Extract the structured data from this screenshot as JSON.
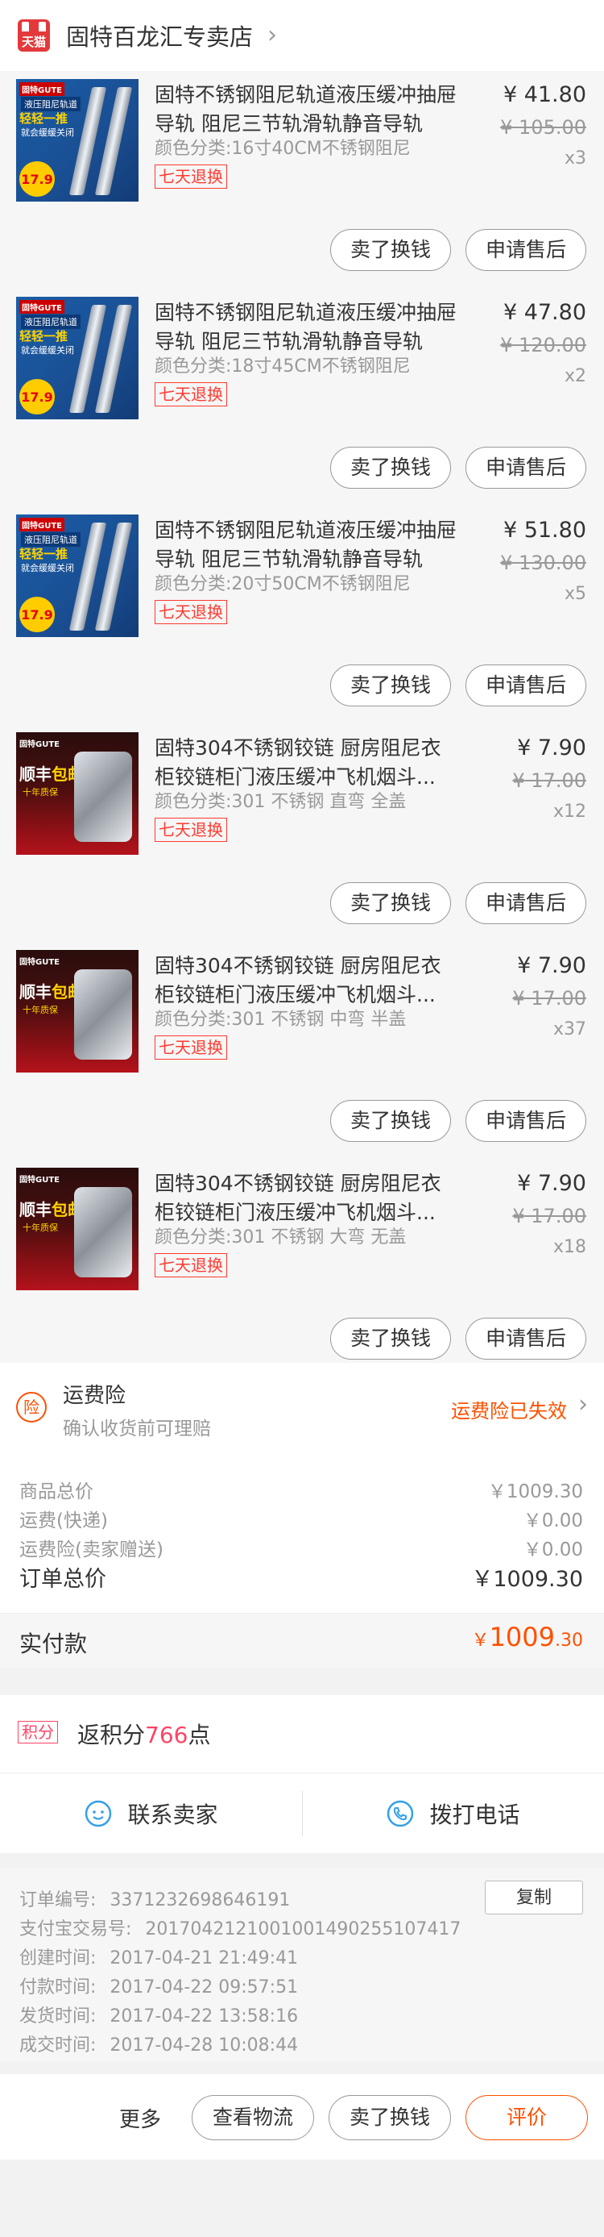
{
  "shop": {
    "logo_text": "天猫",
    "name": "固特百龙汇专卖店",
    "chevron": "›"
  },
  "items": [
    {
      "title": "固特不锈钢阻尼轨道液压缓冲抽屉导轨 阻尼三节轨滑轨静音导轨",
      "sku": "颜色分类:16寸40CM不锈钢阻尼",
      "badge": "七天退换",
      "price": "¥ 41.80",
      "original_price": "¥ 105.00",
      "quantity": "x3",
      "sell_label": "卖了换钱",
      "after_sale_label": "申请售后",
      "thumb": {
        "type": "rail",
        "brand": "固特GUTE",
        "tag1": "液压阻尼轨道",
        "tag2": "轻轻一推",
        "tag3": "就会缓缓关闭",
        "badge": "17.9"
      }
    },
    {
      "title": "固特不锈钢阻尼轨道液压缓冲抽屉导轨 阻尼三节轨滑轨静音导轨",
      "sku": "颜色分类:18寸45CM不锈钢阻尼",
      "badge": "七天退换",
      "price": "¥ 47.80",
      "original_price": "¥ 120.00",
      "quantity": "x2",
      "sell_label": "卖了换钱",
      "after_sale_label": "申请售后",
      "thumb": {
        "type": "rail",
        "brand": "固特GUTE",
        "tag1": "液压阻尼轨道",
        "tag2": "轻轻一推",
        "tag3": "就会缓缓关闭",
        "badge": "17.9"
      }
    },
    {
      "title": "固特不锈钢阻尼轨道液压缓冲抽屉导轨 阻尼三节轨滑轨静音导轨",
      "sku": "颜色分类:20寸50CM不锈钢阻尼",
      "badge": "七天退换",
      "price": "¥ 51.80",
      "original_price": "¥ 130.00",
      "quantity": "x5",
      "sell_label": "卖了换钱",
      "after_sale_label": "申请售后",
      "thumb": {
        "type": "rail",
        "brand": "固特GUTE",
        "tag1": "液压阻尼轨道",
        "tag2": "轻轻一推",
        "tag3": "就会缓缓关闭",
        "badge": "17.9"
      }
    },
    {
      "title": "固特304不锈钢铰链 厨房阻尼衣柜铰链柜门液压缓冲飞机烟斗...",
      "sku": "颜色分类:301 不锈钢 直弯 全盖",
      "badge": "七天退换",
      "price": "¥ 7.90",
      "original_price": "¥ 17.00",
      "quantity": "x12",
      "sell_label": "卖了换钱",
      "after_sale_label": "申请售后",
      "thumb": {
        "type": "hinge",
        "brand": "固特GUTE",
        "big": "顺丰",
        "big2": "包邮",
        "sub": "十年质保"
      }
    },
    {
      "title": "固特304不锈钢铰链 厨房阻尼衣柜铰链柜门液压缓冲飞机烟斗...",
      "sku": "颜色分类:301 不锈钢 中弯 半盖",
      "badge": "七天退换",
      "price": "¥ 7.90",
      "original_price": "¥ 17.00",
      "quantity": "x37",
      "sell_label": "卖了换钱",
      "after_sale_label": "申请售后",
      "thumb": {
        "type": "hinge",
        "brand": "固特GUTE",
        "big": "顺丰",
        "big2": "包邮",
        "sub": "十年质保"
      }
    },
    {
      "title": "固特304不锈钢铰链 厨房阻尼衣柜铰链柜门液压缓冲飞机烟斗...",
      "sku": "颜色分类:301 不锈钢 大弯 无盖",
      "badge": "七天退换",
      "price": "¥ 7.90",
      "original_price": "¥ 17.00",
      "quantity": "x18",
      "sell_label": "卖了换钱",
      "after_sale_label": "申请售后",
      "thumb": {
        "type": "hinge",
        "brand": "固特GUTE",
        "big": "顺丰",
        "big2": "包邮",
        "sub": "十年质保"
      }
    }
  ],
  "insurance": {
    "icon_text": "险",
    "title": "运费险",
    "desc": "确认收货前可理赔",
    "status": "运费险已失效",
    "chevron": "›"
  },
  "costs": {
    "goods_label": "商品总价",
    "goods_value": "￥1009.30",
    "shipping_label": "运费(快递)",
    "shipping_value": "￥0.00",
    "insurance_label": "运费险(卖家赠送)",
    "insurance_value": "￥0.00",
    "total_label": "订单总价",
    "total_value": "￥1009.30"
  },
  "paid": {
    "label": "实付款",
    "currency": "￥",
    "amount_int": "1009",
    "amount_dec": ".30"
  },
  "points": {
    "tag": "积分",
    "prefix": "返积分",
    "value": "766",
    "suffix": "点"
  },
  "contact": {
    "seller_label": "联系卖家",
    "phone_label": "拨打电话",
    "seller_icon": "chat-icon",
    "phone_icon": "phone-icon"
  },
  "order_info": {
    "order_no_label": "订单编号:",
    "order_no": "3371232698646191",
    "alipay_label": "支付宝交易号:",
    "alipay_no": "2017042121001001490255107417",
    "created_label": "创建时间:",
    "created": "2017-04-21 21:49:41",
    "paid_label": "付款时间:",
    "paid": "2017-04-22 09:57:51",
    "shipped_label": "发货时间:",
    "shipped": "2017-04-22 13:58:16",
    "completed_label": "成交时间:",
    "completed": "2017-04-28 10:08:44",
    "copy_label": "复制"
  },
  "bottom_bar": {
    "more_label": "更多",
    "logistics_label": "查看物流",
    "sell_label": "卖了换钱",
    "review_label": "评价"
  },
  "colors": {
    "accent": "#ff5000",
    "return_badge": "#ff3b30",
    "points": "#ff4466",
    "tmall_red": "#e4393c"
  }
}
